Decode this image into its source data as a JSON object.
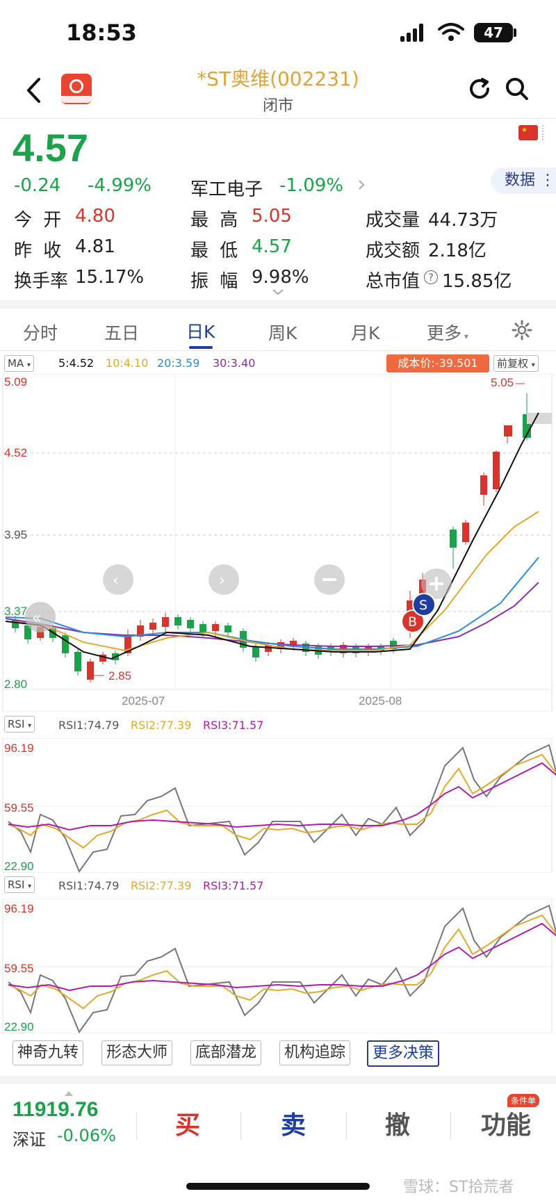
{
  "status_bar": {
    "time": "18:53",
    "battery": "47"
  },
  "header": {
    "title": "*ST奥维(002231)",
    "subtitle": "闭市"
  },
  "quote": {
    "price": "4.57",
    "change": "-0.24",
    "change_pct": "-4.99%",
    "sector": "军工电子",
    "sector_pct": "-1.09%",
    "data_button": "数据",
    "open_label": "今 开",
    "open": "4.80",
    "prev_label": "昨 收",
    "prev": "4.81",
    "turnover_label": "换手率",
    "turnover": "15.17%",
    "high_label": "最 高",
    "high": "5.05",
    "low_label": "最 低",
    "low": "4.57",
    "amp_label": "振 幅",
    "amp": "9.98%",
    "vol_label": "成交量",
    "vol": "44.73万",
    "amt_label": "成交额",
    "amt": "2.18亿",
    "mcap_label": "总市值",
    "mcap": "15.85亿"
  },
  "tabs": [
    "分时",
    "五日",
    "日K",
    "周K",
    "月K",
    "更多"
  ],
  "kline": {
    "ma_selector": "MA",
    "ma5": "5:4.52",
    "ma10": "10:4.10",
    "ma20": "20:3.59",
    "ma30": "30:3.40",
    "cost_label": "成本价:-39.501",
    "adjust": "前复权",
    "y_labels": [
      "5.09",
      "4.52",
      "3.95",
      "3.37",
      "2.80"
    ],
    "x_labels": [
      "2025-07",
      "2025-08"
    ],
    "high_mark": "5.05",
    "low_mark": "2.85",
    "buy_mark": "B",
    "sell_mark": "S"
  },
  "rsi1": {
    "selector": "RSI",
    "rsi1": "RSI1:74.79",
    "rsi2": "RSI2:77.39",
    "rsi3": "RSI3:71.57",
    "y_labels": [
      "96.19",
      "59.55",
      "22.90"
    ]
  },
  "rsi2": {
    "selector": "RSI",
    "rsi1": "RSI1:74.79",
    "rsi2": "RSI2:77.39",
    "rsi3": "RSI3:71.57",
    "y_labels": [
      "96.19",
      "59.55",
      "22.90"
    ]
  },
  "tools": [
    "神奇九转",
    "形态大师",
    "底部潜龙",
    "机构追踪",
    "更多决策"
  ],
  "bottom": {
    "index_value": "11919.76",
    "index_name": "深证",
    "index_pct": "-0.06%",
    "buy": "买",
    "sell": "卖",
    "cancel": "撤",
    "func": "功能",
    "func_badge": "条件单",
    "watermark": "雪球：ST拾荒者"
  },
  "colors": {
    "up": "#d9342b",
    "down": "#1ba24a",
    "accent": "#1d3ea0",
    "ma5": "#111111",
    "ma10": "#e3a92b",
    "ma20": "#2a8fd6",
    "ma30": "#8e2bb5"
  }
}
